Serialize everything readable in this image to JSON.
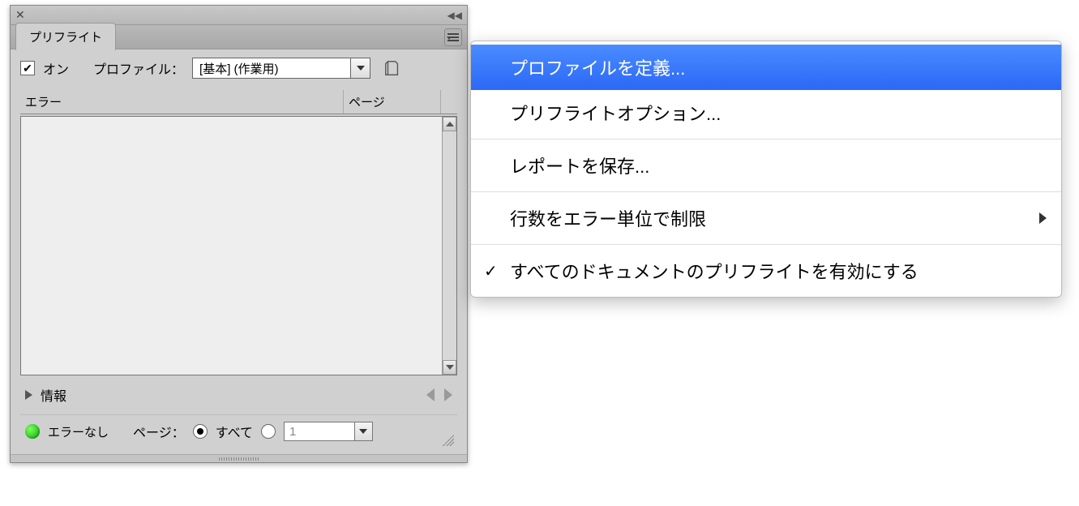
{
  "panel": {
    "tab": "プリフライト",
    "on_checked": true,
    "on_label": "オン",
    "profile_label": "プロファイル：",
    "profile_value": "[基本] (作業用)",
    "table": {
      "col_error": "エラー",
      "col_page": "ページ"
    },
    "info_label": "情報",
    "status": {
      "text": "エラーなし",
      "page_label": "ページ：",
      "radio_all": "すべて",
      "page_value": "1"
    }
  },
  "menu": {
    "items": [
      {
        "label": "プロファイルを定義...",
        "selected": true
      },
      {
        "label": "プリフライトオプション..."
      },
      {
        "sep": true
      },
      {
        "label": "レポートを保存..."
      },
      {
        "sep": true
      },
      {
        "label": "行数をエラー単位で制限",
        "submenu": true
      },
      {
        "sep": true
      },
      {
        "label": "すべてのドキュメントのプリフライトを有効にする",
        "checked": true
      }
    ]
  }
}
